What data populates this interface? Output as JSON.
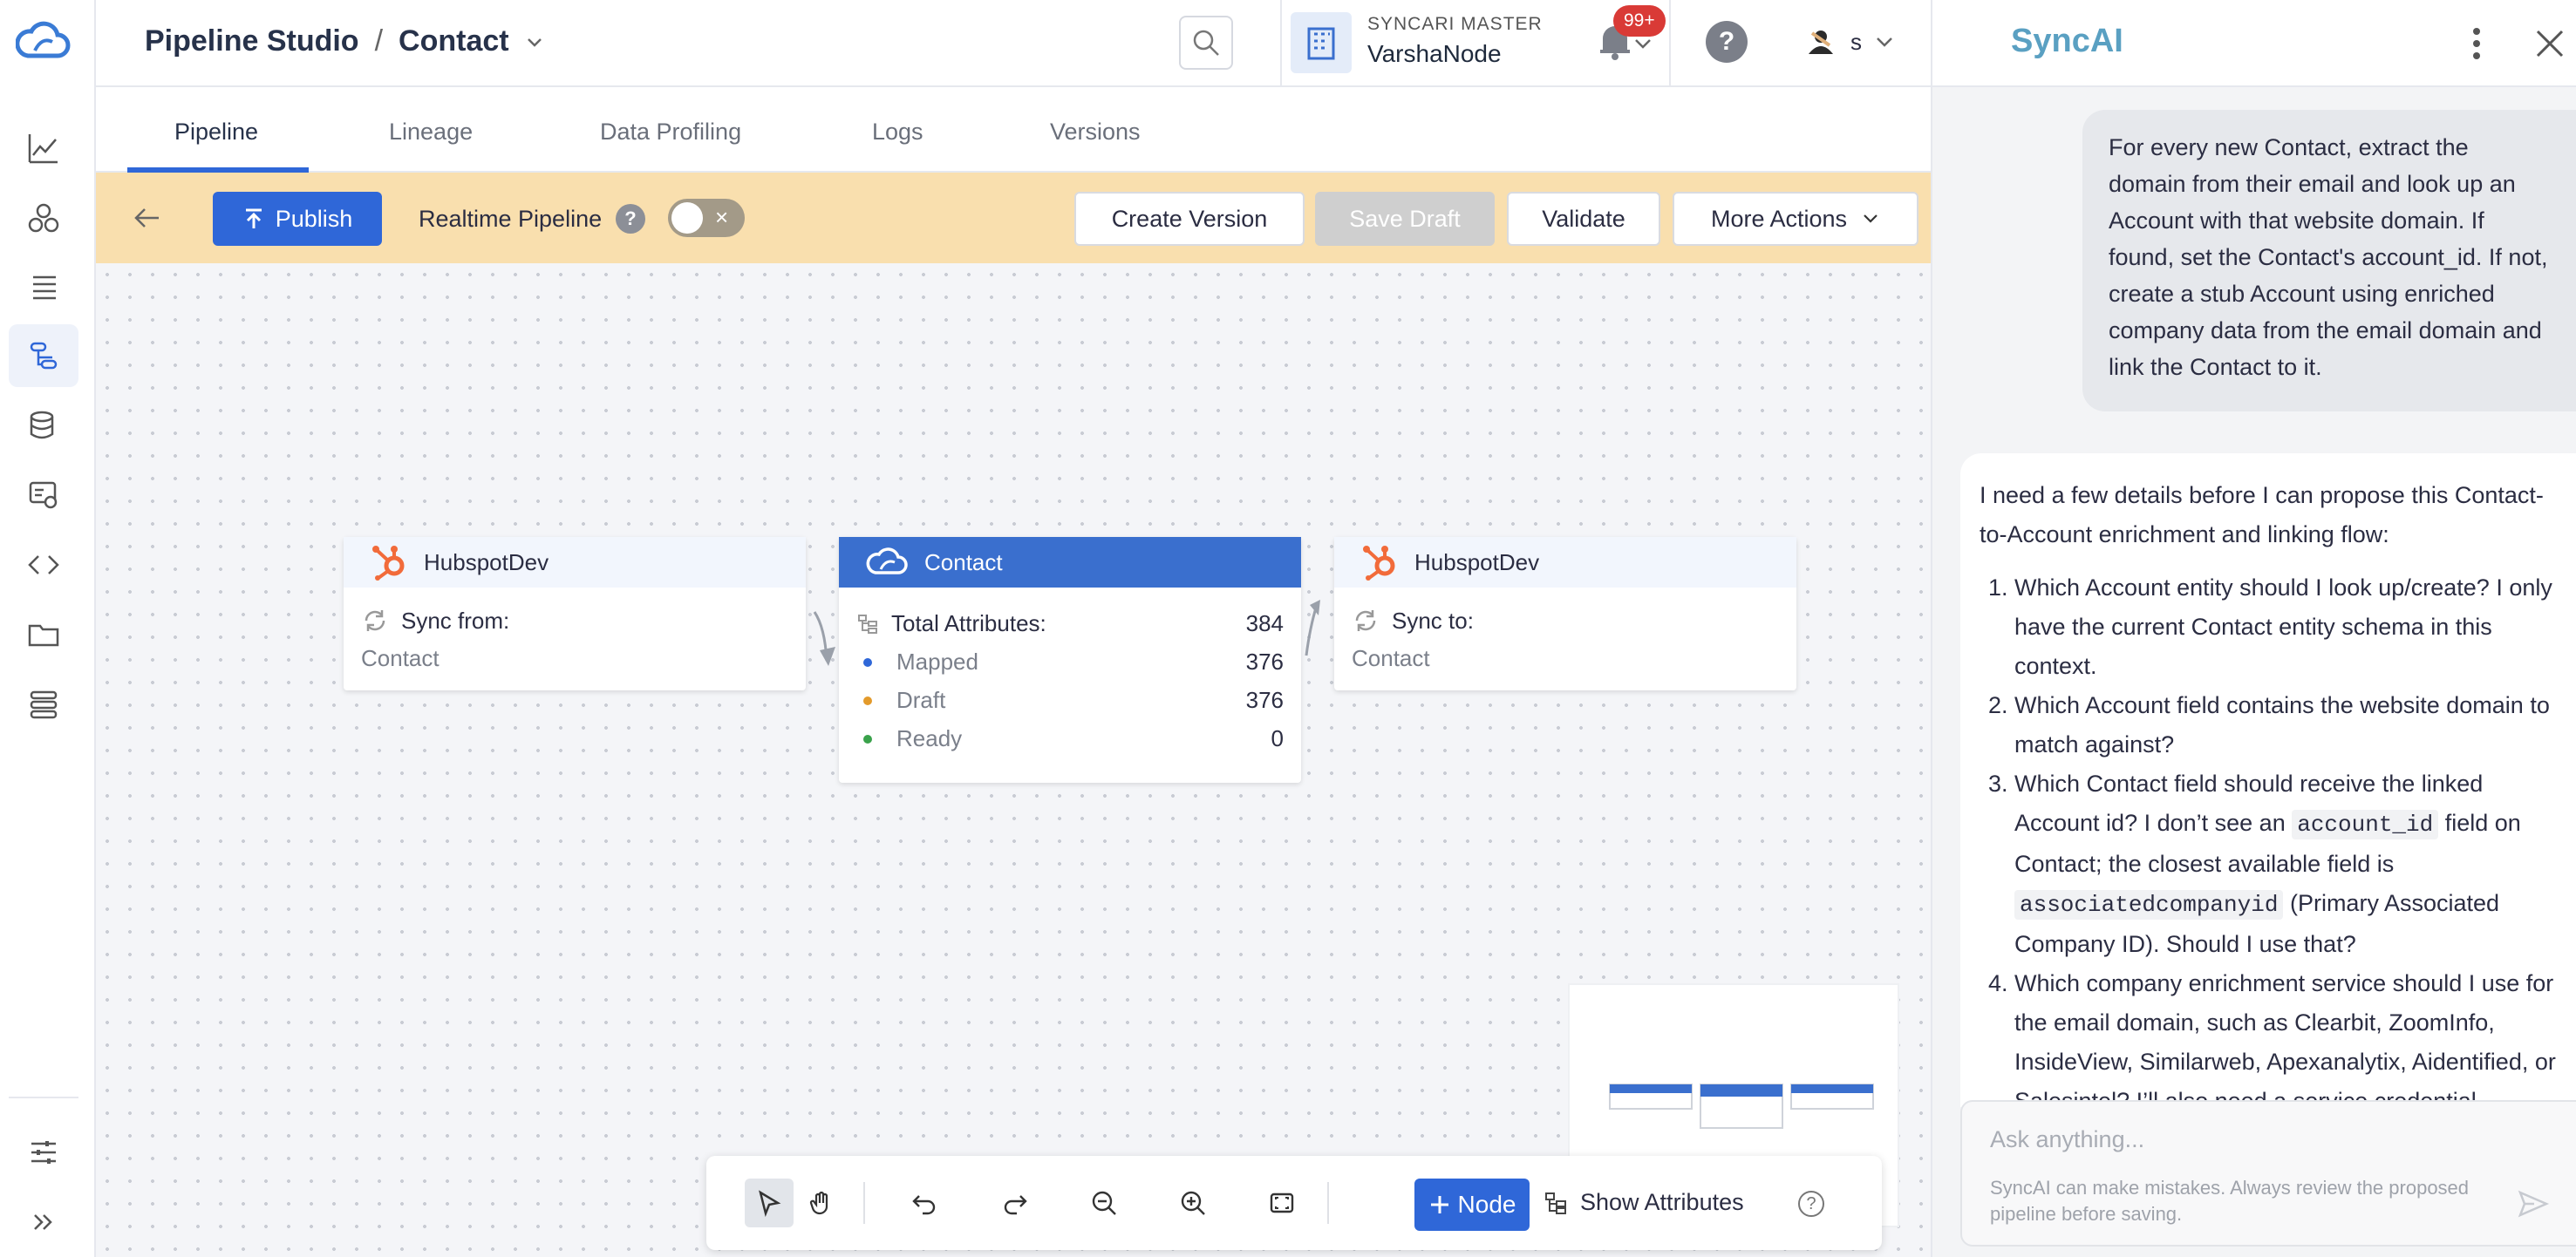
{
  "header": {
    "app_title": "Pipeline Studio",
    "separator": "/",
    "entity": "Contact",
    "org_label": "SYNCARI MASTER",
    "org_name": "VarshaNode",
    "notification_count": "99+",
    "user_initial": "s"
  },
  "tabs": [
    {
      "label": "Pipeline"
    },
    {
      "label": "Lineage"
    },
    {
      "label": "Data Profiling"
    },
    {
      "label": "Logs"
    },
    {
      "label": "Versions"
    }
  ],
  "toolbar": {
    "publish_label": "Publish",
    "realtime_label": "Realtime Pipeline",
    "realtime_help": "?",
    "realtime_toggle_off": "×",
    "create_version_label": "Create Version",
    "save_draft_label": "Save Draft",
    "validate_label": "Validate",
    "more_actions_label": "More Actions"
  },
  "nodes": {
    "source": {
      "title": "HubspotDev",
      "sync_label": "Sync from:",
      "entity": "Contact"
    },
    "entity": {
      "title": "Contact",
      "total_label": "Total Attributes:",
      "total_value": "384",
      "mapped_label": "Mapped",
      "mapped_value": "376",
      "draft_label": "Draft",
      "draft_value": "376",
      "ready_label": "Ready",
      "ready_value": "0"
    },
    "destination": {
      "title": "HubspotDev",
      "sync_label": "Sync to:",
      "entity": "Contact"
    }
  },
  "bottombar": {
    "node_label": "Node",
    "show_attributes_label": "Show Attributes",
    "help": "?"
  },
  "chat": {
    "title": "SyncAI",
    "user_message": "For every new Contact, extract the domain from their email and look up an Account with that website domain. If found, set the Contact's account_id. If not, create a stub Account using enriched company data from the email domain and link the Contact to it.",
    "bot_intro": "I need a few details before I can propose this Contact-to-Account enrichment and linking flow:",
    "bot_q1": "Which Account entity should I look up/create? I only have the current Contact entity schema in this context.",
    "bot_q2": "Which Account field contains the website domain to match against?",
    "bot_q3_a": "Which Contact field should receive the linked Account id? I don’t see an ",
    "bot_q3_code1": "account_id",
    "bot_q3_b": " field on Contact; the closest available field is ",
    "bot_q3_code2": "associatedcompanyid",
    "bot_q3_c": " (Primary Associated Company ID). Should I use that?",
    "bot_q4": "Which company enrichment service should I use for the email domain, such as Clearbit, ZoomInfo, InsideView, Similarweb, Apexanalytix, Aidentified, or Salesintel? I’ll also need a service credential",
    "input_placeholder": "Ask anything...",
    "disclaimer": "SyncAI can make mistakes. Always review the proposed pipeline before saving."
  },
  "colors": {
    "primary": "#2f67d8",
    "toolbar_band": "#f9dfae",
    "node_header": "#3a6fce",
    "mapped_dot": "#2f67d8",
    "draft_dot": "#e39a2b",
    "ready_dot": "#3aa24b",
    "hubspot": "#f26b3a",
    "syncai": "#5aa0c2"
  }
}
